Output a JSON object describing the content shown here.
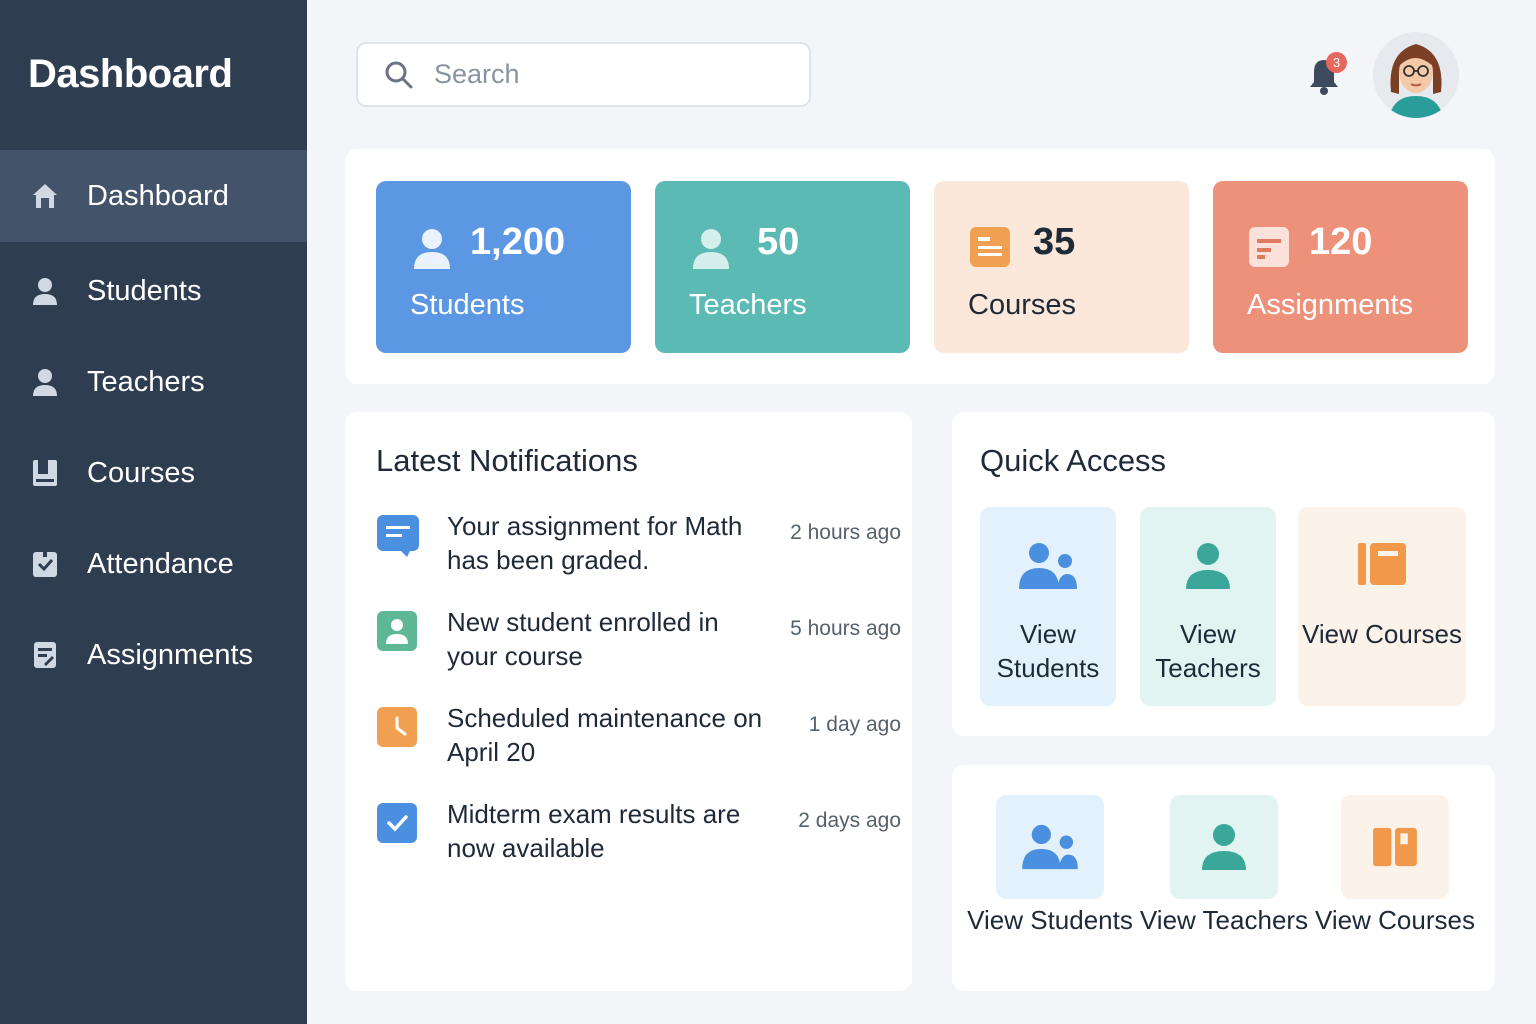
{
  "sidebar": {
    "title": "Dashboard",
    "items": [
      {
        "label": "Dashboard",
        "icon": "home-icon",
        "active": true
      },
      {
        "label": "Students",
        "icon": "person-icon"
      },
      {
        "label": "Teachers",
        "icon": "person-icon"
      },
      {
        "label": "Courses",
        "icon": "book-icon"
      },
      {
        "label": "Attendance",
        "icon": "clipboard-check-icon"
      },
      {
        "label": "Assignments",
        "icon": "document-icon"
      }
    ]
  },
  "header": {
    "search_placeholder": "Search",
    "notification_count": "3"
  },
  "stats": [
    {
      "value": "1,200",
      "label": "Students",
      "color": "#5b97e2",
      "icon": "person-icon"
    },
    {
      "value": "50",
      "label": "Teachers",
      "color": "#5bbab4",
      "icon": "person-icon"
    },
    {
      "value": "35",
      "label": "Courses",
      "color": "#fce8da",
      "icon": "book-icon"
    },
    {
      "value": "120",
      "label": "Assignments",
      "color": "#ed917a",
      "icon": "document-icon"
    }
  ],
  "notifications": {
    "title": "Latest Notifications",
    "items": [
      {
        "text": "Your assignment for Math has been graded.",
        "time": "2 hours ago",
        "icon": "message-icon"
      },
      {
        "text": "New student enrolled in your course",
        "time": "5 hours ago",
        "icon": "student-icon"
      },
      {
        "text": "Scheduled maintenance on April 20",
        "time": "1 day ago",
        "icon": "clock-icon"
      },
      {
        "text": "Midterm exam results are now available",
        "time": "2 days ago",
        "icon": "checkbox-icon"
      }
    ]
  },
  "quick_access": {
    "title": "Quick Access",
    "tiles": [
      {
        "label": "View Students",
        "icon": "group-icon"
      },
      {
        "label": "View Teachers",
        "icon": "person-icon"
      },
      {
        "label": "View Courses",
        "icon": "book-icon"
      }
    ]
  },
  "quick_access_2": {
    "tiles": [
      {
        "label": "View Students",
        "icon": "group-icon"
      },
      {
        "label": "View Teachers",
        "icon": "person-icon"
      },
      {
        "label": "View Courses",
        "icon": "book-icon"
      }
    ]
  }
}
